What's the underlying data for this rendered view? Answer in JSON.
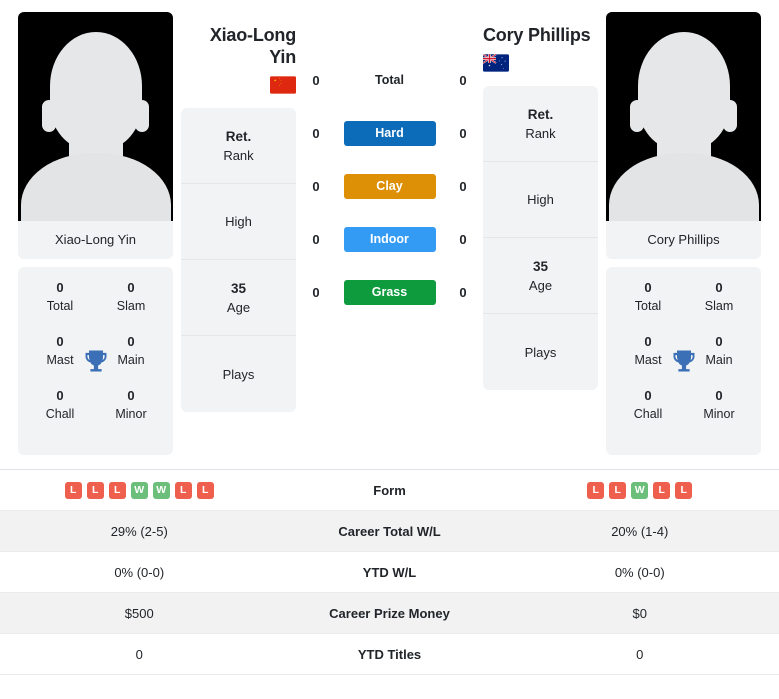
{
  "colors": {
    "hard": "#0c6cba",
    "clay": "#dd9005",
    "indoor": "#339bf4",
    "grass": "#0d9b3e",
    "win": "#6cbf7a",
    "loss": "#ef5f4d",
    "trophy": "#3b6fb6",
    "panel_bg": "#f1f3f5",
    "row_shade": "#f2f2f3"
  },
  "left_player": {
    "name": "Xiao-Long Yin",
    "name_line1": "Xiao-Long",
    "name_line2": "Yin",
    "photo_caption": "Xiao-Long Yin",
    "flag": "flag-china",
    "flag_name": "China",
    "titles": {
      "total_value": "0",
      "total_label": "Total",
      "slam_value": "0",
      "slam_label": "Slam",
      "mast_value": "0",
      "mast_label": "Mast",
      "main_value": "0",
      "main_label": "Main",
      "chall_value": "0",
      "chall_label": "Chall",
      "minor_value": "0",
      "minor_label": "Minor",
      "icon": "trophy-icon"
    },
    "stats": [
      {
        "value": "Ret.",
        "label": "Rank"
      },
      {
        "value": "",
        "label": "High"
      },
      {
        "value": "35",
        "label": "Age"
      },
      {
        "value": "",
        "label": "Plays"
      }
    ],
    "surface_scores": [
      "0",
      "0",
      "0",
      "0",
      "0"
    ],
    "form": [
      "L",
      "L",
      "L",
      "W",
      "W",
      "L",
      "L"
    ]
  },
  "right_player": {
    "name": "Cory Phillips",
    "name_line1": "Cory Phillips",
    "name_line2": "",
    "photo_caption": "Cory Phillips",
    "flag": "flag-australia",
    "flag_name": "Australia",
    "titles": {
      "total_value": "0",
      "total_label": "Total",
      "slam_value": "0",
      "slam_label": "Slam",
      "mast_value": "0",
      "mast_label": "Mast",
      "main_value": "0",
      "main_label": "Main",
      "chall_value": "0",
      "chall_label": "Chall",
      "minor_value": "0",
      "minor_label": "Minor",
      "icon": "trophy-icon"
    },
    "stats": [
      {
        "value": "Ret.",
        "label": "Rank"
      },
      {
        "value": "",
        "label": "High"
      },
      {
        "value": "35",
        "label": "Age"
      },
      {
        "value": "",
        "label": "Plays"
      }
    ],
    "surface_scores": [
      "0",
      "0",
      "0",
      "0",
      "0"
    ],
    "form": [
      "L",
      "L",
      "W",
      "L",
      "L"
    ]
  },
  "surfaces": [
    {
      "label": "Total",
      "style": "plain"
    },
    {
      "label": "Hard",
      "style": "hard"
    },
    {
      "label": "Clay",
      "style": "clay"
    },
    {
      "label": "Indoor",
      "style": "indoor"
    },
    {
      "label": "Grass",
      "style": "grass"
    }
  ],
  "table": {
    "rows": [
      {
        "label": "Form",
        "left": "",
        "right": "",
        "type": "form",
        "shaded": false
      },
      {
        "label": "Career Total W/L",
        "left": "29% (2-5)",
        "right": "20% (1-4)",
        "type": "text",
        "shaded": true
      },
      {
        "label": "YTD W/L",
        "left": "0% (0-0)",
        "right": "0% (0-0)",
        "type": "text",
        "shaded": false
      },
      {
        "label": "Career Prize Money",
        "left": "$500",
        "right": "$0",
        "type": "text",
        "shaded": true
      },
      {
        "label": "YTD Titles",
        "left": "0",
        "right": "0",
        "type": "text",
        "shaded": false
      }
    ]
  }
}
